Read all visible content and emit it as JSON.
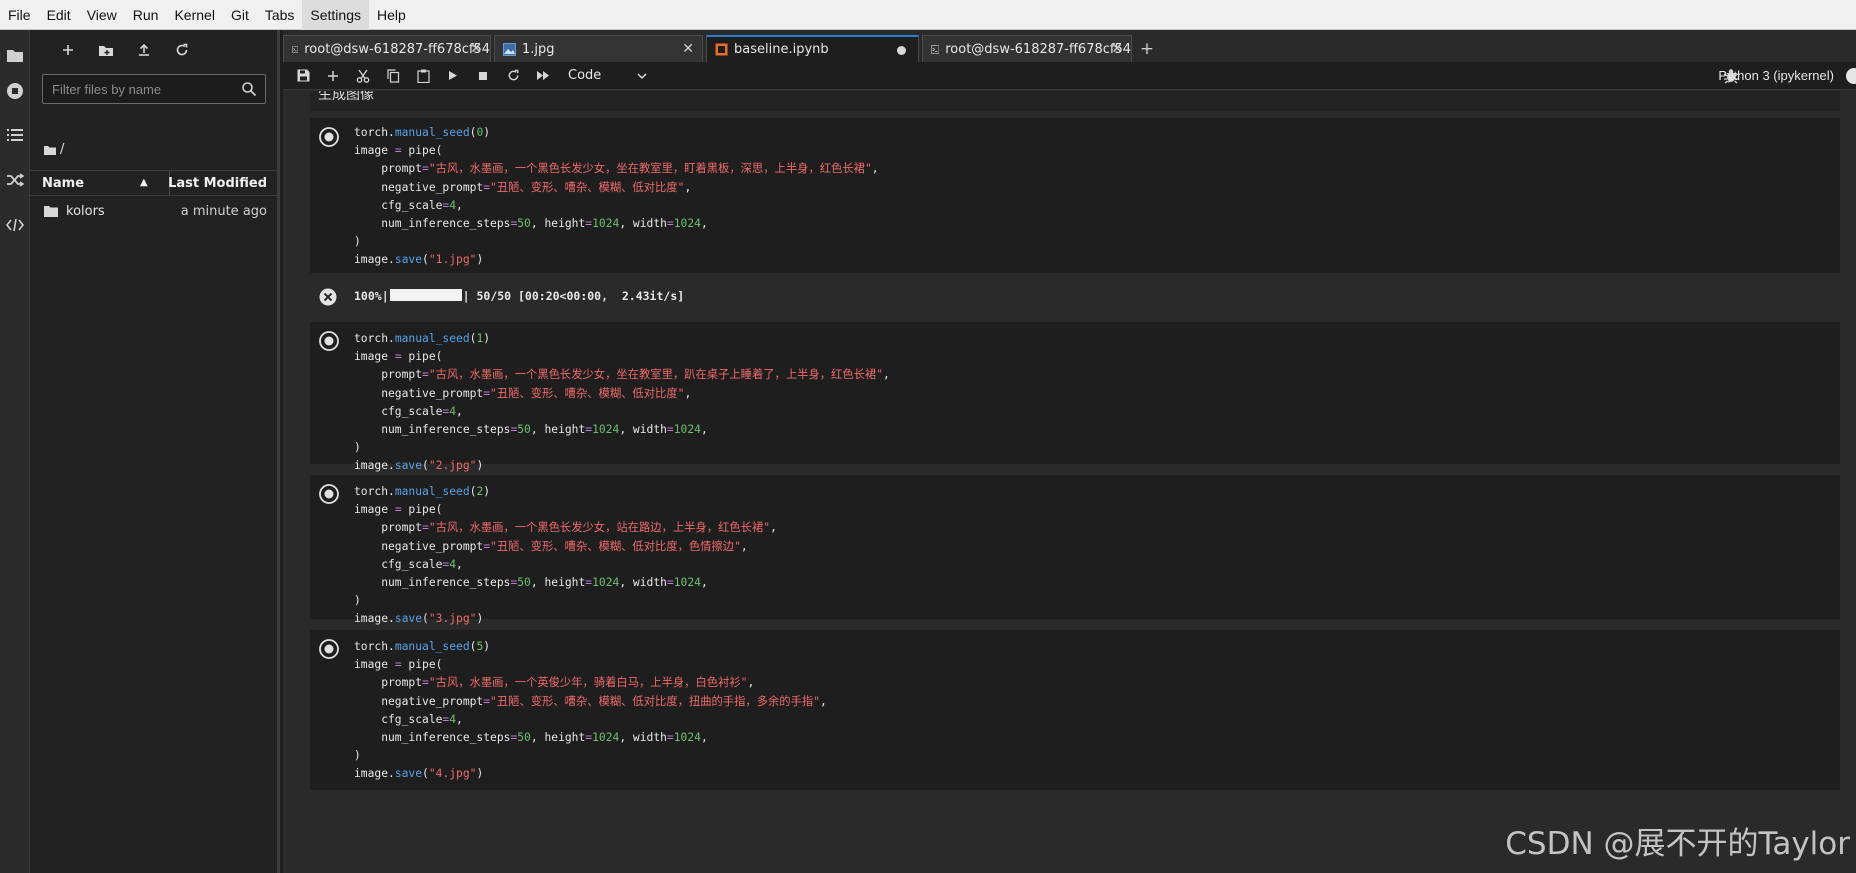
{
  "menubar": {
    "items": [
      "File",
      "Edit",
      "View",
      "Run",
      "Kernel",
      "Git",
      "Tabs",
      "Settings",
      "Help"
    ],
    "active_index": 7
  },
  "activity_bar": {
    "icons": [
      "folder-icon",
      "running-icon",
      "toc-icon",
      "git-icon",
      "extension-icon"
    ]
  },
  "sidebar": {
    "filter_placeholder": "Filter files by name",
    "breadcrumb": "/",
    "columns": {
      "name": "Name",
      "modified": "Last Modified"
    },
    "files": [
      {
        "name": "kolors",
        "modified": "a minute ago",
        "type": "folder"
      }
    ]
  },
  "tabs": [
    {
      "label": "root@dsw-618287-ff678cf54",
      "icon": "terminal-icon",
      "active": false
    },
    {
      "label": "1.jpg",
      "icon": "image-icon",
      "active": false
    },
    {
      "label": "baseline.ipynb",
      "icon": "notebook-icon",
      "active": true,
      "dirty": true
    },
    {
      "label": "root@dsw-618287-ff678cf54",
      "icon": "terminal-icon",
      "active": false
    }
  ],
  "toolbar": {
    "cell_type": "Code",
    "kernel": "Python 3 (ipykernel)"
  },
  "notebook": {
    "markdown_heading": "生成图像",
    "cells": [
      {
        "seed": "0",
        "prompt": "古风，水墨画，一个黑色长发少女，坐在教室里，盯着黑板，深思，上半身，红色长裙",
        "negative": "丑陋、变形、嘈杂、模糊、低对比度",
        "file": "1.jpg"
      },
      {
        "seed": "1",
        "prompt": "古风，水墨画，一个黑色长发少女，坐在教室里，趴在桌子上睡着了，上半身，红色长裙",
        "negative": "丑陋、变形、嘈杂、模糊、低对比度",
        "file": "2.jpg"
      },
      {
        "seed": "2",
        "prompt": "古风，水墨画，一个黑色长发少女，站在路边，上半身，红色长裙",
        "negative": "丑陋、变形、嘈杂、模糊、低对比度，色情擦边",
        "file": "3.jpg"
      },
      {
        "seed": "5",
        "prompt": "古风，水墨画，一个英俊少年，骑着白马，上半身，白色衬衫",
        "negative": "丑陋、变形、嘈杂、模糊、低对比度，扭曲的手指，多余的手指",
        "file": "4.jpg"
      }
    ],
    "code": {
      "torch": "torch.",
      "manual_seed": "manual_seed",
      "image_eq": "image ",
      "pipe_open": " pipe(",
      "prompt_key": "    prompt",
      "negative_key": "    negative_prompt",
      "cfg_key": "    cfg_scale",
      "cfg_val": "4",
      "steps_key": "    num_inference_steps",
      "steps_val": "50",
      "height_key": ", height",
      "height_val": "1024",
      "width_key": ", width",
      "width_val": "1024",
      "close": ")",
      "image_dot": "image.",
      "save": "save"
    },
    "output": {
      "percent": "100%|",
      "rest": "| 50/50 [00:20<00:00,  2.43it/s]"
    }
  },
  "watermark": "CSDN @展不开的Taylor",
  "colors": {
    "accent": "#2a7fd4",
    "code_fn": "#57a3e8",
    "code_num": "#6cc06c",
    "code_str": "#f06a6a"
  }
}
